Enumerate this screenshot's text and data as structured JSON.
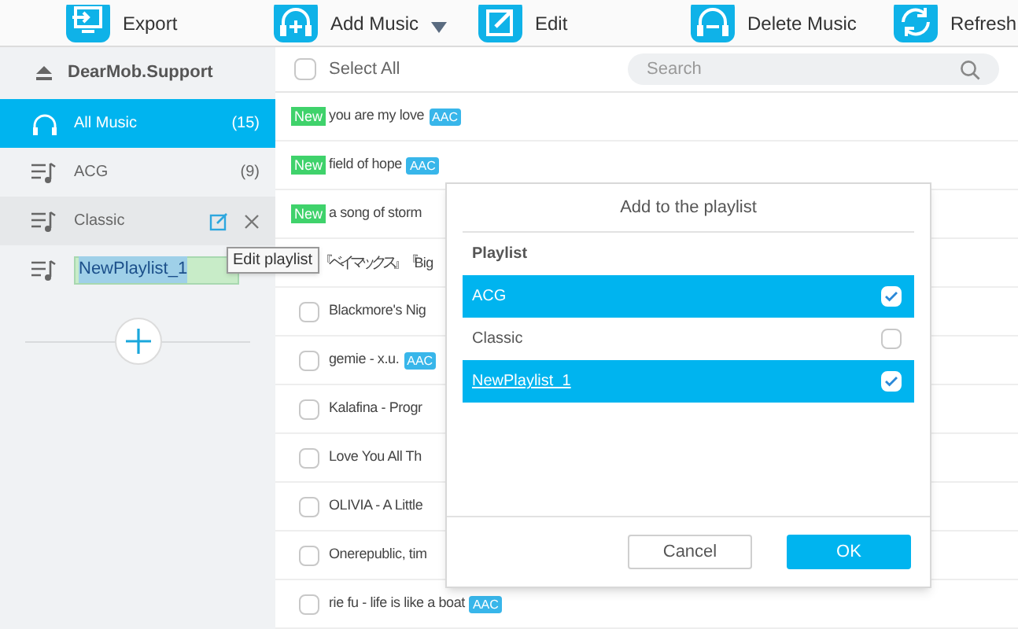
{
  "toolbar": [
    {
      "label": "Export",
      "kind": "export",
      "dropdown": false
    },
    {
      "label": "Add Music",
      "kind": "add",
      "dropdown": true
    },
    {
      "label": "Edit",
      "kind": "edit",
      "dropdown": false
    },
    {
      "label": "Delete Music",
      "kind": "delete",
      "dropdown": false
    },
    {
      "label": "Refresh",
      "kind": "refresh",
      "dropdown": false
    }
  ],
  "sidebar": {
    "device": "DearMob.Support",
    "items": [
      {
        "kind": "all",
        "label": "All Music",
        "count": "(15)",
        "selected": true,
        "hovered": false,
        "editing": false
      },
      {
        "kind": "playlist",
        "label": "ACG",
        "count": "(9)",
        "selected": false,
        "hovered": false,
        "editing": false
      },
      {
        "kind": "playlist",
        "label": "Classic",
        "selected": false,
        "hovered": true,
        "editing": false
      },
      {
        "kind": "playlist",
        "label": "NewPlaylist_1",
        "selected": false,
        "hovered": false,
        "editing": true
      }
    ],
    "tooltip": "Edit playlist"
  },
  "list": {
    "select_all": "Select All",
    "select_all_checked": false,
    "search": {
      "placeholder": "Search"
    },
    "rows": [
      {
        "title": "you are my love",
        "new": "New",
        "format": "AAC"
      },
      {
        "title": "field of hope",
        "new": "New",
        "format": "AAC"
      },
      {
        "title": "a song of storm",
        "new": "New"
      },
      {
        "title": "『ベイマックス』『Big"
      },
      {
        "title": "Blackmore's Nig",
        "checked": false
      },
      {
        "title": "gemie - x.u.",
        "format": "AAC",
        "checked": false
      },
      {
        "title": "Kalafina - Progr",
        "checked": false
      },
      {
        "title": "Love You All Th",
        "checked": false
      },
      {
        "title": "OLIVIA - A Little",
        "checked": false
      },
      {
        "title": "Onerepublic, tim",
        "checked": false
      },
      {
        "title": "rie fu - life is like a boat",
        "format": "AAC",
        "checked": false
      }
    ]
  },
  "dialog": {
    "title": "Add to the playlist",
    "column": "Playlist",
    "items": [
      {
        "label": "ACG",
        "checked": true,
        "underlined": false
      },
      {
        "label": "Classic",
        "checked": false,
        "underlined": false
      },
      {
        "label": "NewPlaylist_1",
        "checked": true,
        "underlined": true
      }
    ],
    "buttons": [
      {
        "label": "Cancel",
        "kind": "secondary"
      },
      {
        "label": "OK",
        "kind": "primary"
      }
    ]
  }
}
